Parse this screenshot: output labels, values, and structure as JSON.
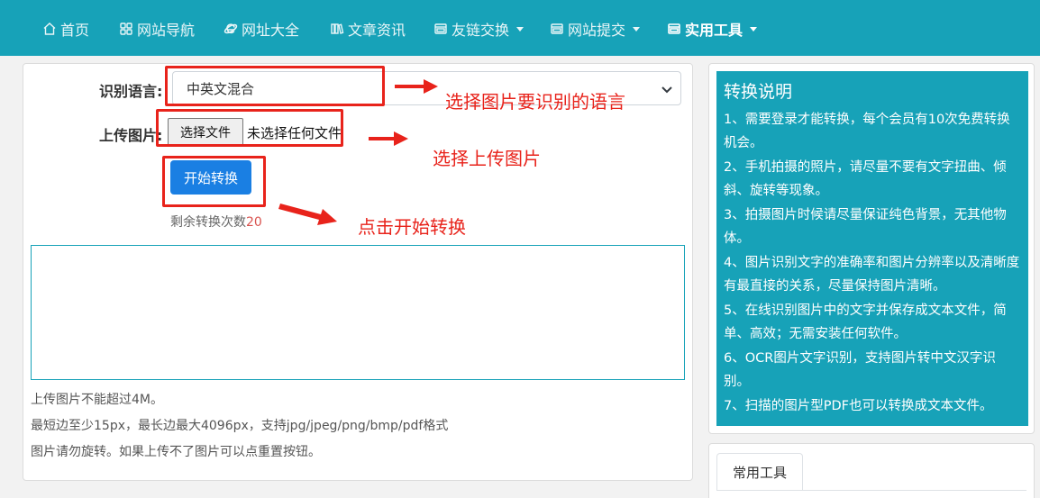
{
  "nav": {
    "items": [
      {
        "label": "首页",
        "icon": "home-icon"
      },
      {
        "label": "网站导航",
        "icon": "grid-icon"
      },
      {
        "label": "网址大全",
        "icon": "ie-icon"
      },
      {
        "label": "文章资讯",
        "icon": "books-icon"
      },
      {
        "label": "友链交换",
        "icon": "window-icon"
      },
      {
        "label": "网站提交",
        "icon": "window-icon"
      },
      {
        "label": "实用工具",
        "icon": "window-icon"
      }
    ]
  },
  "form": {
    "language_label": "识别语言:",
    "language_value": "中英文混合",
    "upload_label": "上传图片:",
    "file_button": "选择文件",
    "file_status": "未选择任何文件",
    "start_button": "开始转换",
    "remaining_prefix": "剩余转换次数",
    "remaining_count": "20"
  },
  "notes": [
    "上传图片不能超过4M。",
    "最短边至少15px，最长边最大4096px，支持jpg/jpeg/png/bmp/pdf格式",
    "图片请勿旋转。如果上传不了图片可以点重置按钮。"
  ],
  "annotations": {
    "language": "选择图片要识别的语言",
    "upload": "选择上传图片",
    "start": "点击开始转换"
  },
  "info": {
    "title": "转换说明",
    "items": [
      "1、需要登录才能转换，每个会员有10次免费转换机会。",
      "2、手机拍摄的照片，请尽量不要有文字扭曲、倾斜、旋转等现象。",
      "3、拍摄图片时候请尽量保证纯色背景，无其他物体。",
      "4、图片识别文字的准确率和图片分辨率以及清晰度有最直接的关系，尽量保持图片清晰。",
      "5、在线识别图片中的文字并保存成文本文件，简单、高效；无需安装任何软件。",
      "6、OCR图片文字识别，支持图片转中文汉字识别。",
      "7、扫描的图片型PDF也可以转换成文本文件。"
    ]
  },
  "tools": {
    "tab_label": "常用工具"
  },
  "colors": {
    "nav_bg": "#17a2b8",
    "primary": "#1a7fe3",
    "annotation": "#e8231b",
    "count": "#d9534f"
  }
}
